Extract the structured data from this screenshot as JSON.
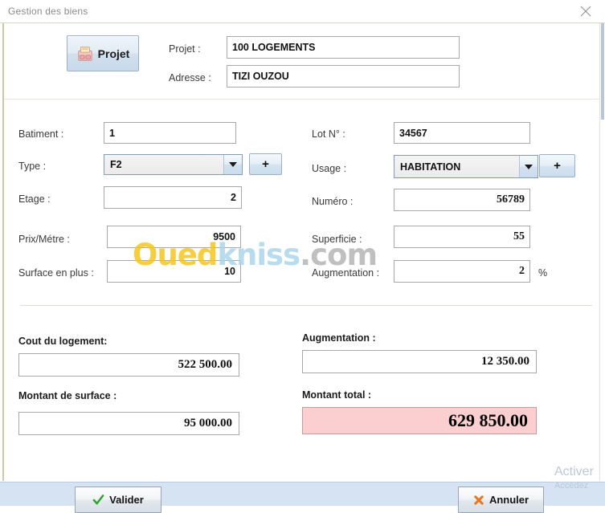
{
  "window": {
    "title": "Gestion des biens",
    "close_icon": "close-icon"
  },
  "header": {
    "projet_button_label": "Projet",
    "projet_button_icon": "project-folder-icon",
    "fields": [
      {
        "label": "Projet :",
        "value": "100 LOGEMENTS"
      },
      {
        "label": "Adresse :",
        "value": "TIZI OUZOU"
      }
    ]
  },
  "form": {
    "left": {
      "batiment_label": "Batiment :",
      "batiment_value": "1",
      "type_label": "Type :",
      "type_value": "F2",
      "type_add_label": "+",
      "etage_label": "Etage :",
      "etage_value": "2",
      "prix_metre_label": "Prix/Métre :",
      "prix_metre_value": "9500",
      "surface_plus_label": "Surface en plus :",
      "surface_plus_value": "10"
    },
    "right": {
      "lot_label": "Lot N° :",
      "lot_value": "34567",
      "usage_label": "Usage :",
      "usage_value": "HABITATION",
      "usage_add_label": "+",
      "numero_label": "Numéro :",
      "numero_value": "56789",
      "superficie_label": "Superficie :",
      "superficie_value": "55",
      "augmentation_label": "Augmentation :",
      "augmentation_value": "2",
      "augmentation_suffix": "%"
    }
  },
  "totals": {
    "cout_logement_label": "Cout du logement:",
    "cout_logement_value": "522 500.00",
    "montant_surface_label": "Montant de surface :",
    "montant_surface_value": "95 000.00",
    "augmentation_label": "Augmentation :",
    "augmentation_value": "12 350.00",
    "montant_total_label": "Montant total :",
    "montant_total_value": "629 850.00",
    "total_bg_color": "#fbcfcf"
  },
  "footer": {
    "validate_label": "Valider",
    "validate_icon": "check-icon",
    "cancel_label": "Annuler",
    "cancel_icon": "cross-burst-icon"
  },
  "activation_notice": {
    "line1": "Activer",
    "line2": "Accédez"
  },
  "watermark": {
    "part1": "Oued",
    "part2": "kniss",
    "part3": ".com",
    "color1": "#f5c518",
    "color2": "#a8d4ec",
    "color3": "#b3b3b3"
  }
}
